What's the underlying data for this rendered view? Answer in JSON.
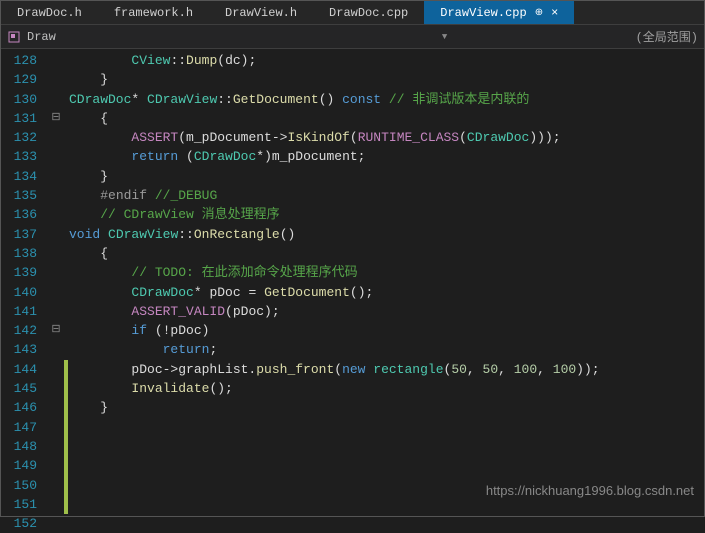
{
  "tabs": [
    {
      "label": "DrawDoc.h",
      "active": false
    },
    {
      "label": "framework.h",
      "active": false
    },
    {
      "label": "DrawView.h",
      "active": false
    },
    {
      "label": "DrawDoc.cpp",
      "active": false
    },
    {
      "label": "DrawView.cpp",
      "active": true
    }
  ],
  "toolbar": {
    "context": "Draw",
    "scope": "(全局范围)"
  },
  "lines": {
    "start": 128,
    "end": 152
  },
  "code": {
    "l128": {
      "indent": "        ",
      "t1": "CView",
      "t2": "::",
      "t3": "Dump",
      "t4": "(dc);"
    },
    "l129": {
      "indent": "    ",
      "t1": "}"
    },
    "l131": {
      "t1": "CDrawDoc",
      "t2": "* ",
      "t3": "CDrawView",
      "t4": "::",
      "t5": "GetDocument",
      "t6": "() ",
      "t7": "const",
      "t8": " // 非调试版本是内联的"
    },
    "l132": {
      "indent": "    ",
      "t1": "{"
    },
    "l133": {
      "indent": "        ",
      "t1": "ASSERT",
      "t2": "(m_pDocument->",
      "t3": "IsKindOf",
      "t4": "(",
      "t5": "RUNTIME_CLASS",
      "t6": "(",
      "t7": "CDrawDoc",
      "t8": ")));"
    },
    "l134": {
      "indent": "        ",
      "t1": "return",
      "t2": " (",
      "t3": "CDrawDoc",
      "t4": "*)m_pDocument;"
    },
    "l135": {
      "indent": "    ",
      "t1": "}"
    },
    "l136": {
      "indent": "    ",
      "t1": "#endif",
      "t2": " //_DEBUG"
    },
    "l139": {
      "indent": "    ",
      "t1": "// CDrawView 消息处理程序"
    },
    "l142": {
      "t1": "void",
      "t2": " ",
      "t3": "CDrawView",
      "t4": "::",
      "t5": "OnRectangle",
      "t6": "()"
    },
    "l143": {
      "indent": "    ",
      "t1": "{"
    },
    "l144": {
      "indent": "        ",
      "t1": "// TODO: 在此添加命令处理程序代码"
    },
    "l145": {
      "indent": "        ",
      "t1": "CDrawDoc",
      "t2": "* pDoc = ",
      "t3": "GetDocument",
      "t4": "();"
    },
    "l146": {
      "indent": "        ",
      "t1": "ASSERT_VALID",
      "t2": "(pDoc);"
    },
    "l147": {
      "indent": "        ",
      "t1": "if",
      "t2": " (!pDoc)"
    },
    "l148": {
      "indent": "            ",
      "t1": "return",
      "t2": ";"
    },
    "l149": {
      "indent": "        ",
      "t1": "pDoc->graphList.",
      "t2": "push_front",
      "t3": "(",
      "t4": "new",
      "t5": " ",
      "t6": "rectangle",
      "t7": "(",
      "n1": "50",
      "c1": ", ",
      "n2": "50",
      "c2": ", ",
      "n3": "100",
      "c3": ", ",
      "n4": "100",
      "t8": "));"
    },
    "l151": {
      "indent": "        ",
      "t1": "Invalidate",
      "t2": "();"
    },
    "l152": {
      "indent": "    ",
      "t1": "}"
    }
  },
  "watermark": "https://nickhuang1996.blog.csdn.net"
}
